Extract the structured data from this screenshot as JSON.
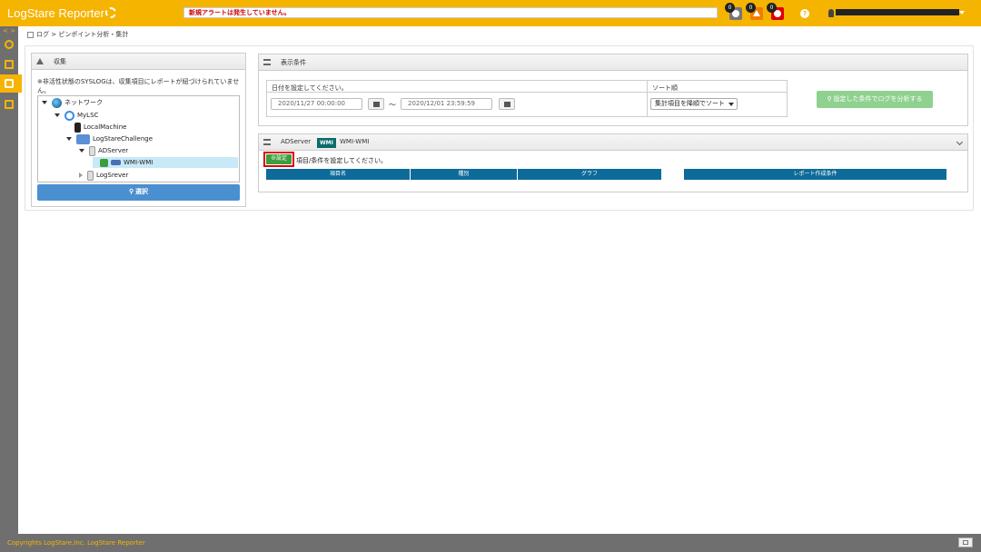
{
  "header": {
    "app_title": "LogStare Reporter",
    "alert_text": "新規アラートは発生していません。",
    "badges": {
      "info": "0",
      "warning": "0",
      "error": "0"
    },
    "help": "?",
    "colors": {
      "brand": "#f5b400",
      "alert_text": "#cc0000"
    }
  },
  "sidebar": {
    "toggle": "< >",
    "items": [
      {
        "name": "search",
        "icon": "search-icon"
      },
      {
        "name": "image",
        "icon": "image-icon"
      },
      {
        "name": "log",
        "icon": "speech-bubble-icon",
        "active": true
      },
      {
        "name": "report",
        "icon": "users-icon"
      }
    ]
  },
  "breadcrumb": "ログ > ピンポイント分析・集計",
  "collect_panel": {
    "title": "収集",
    "note": "※非活性状態のSYSLOGは、収集項目にレポートが紐づけられていません。",
    "tree": [
      {
        "label": "ネットワーク",
        "icon": "globe-icon",
        "level": 0
      },
      {
        "label": "MyLSC",
        "icon": "lsc-icon",
        "level": 1
      },
      {
        "label": "LocalMachine",
        "icon": "pc-icon",
        "level": 2
      },
      {
        "label": "LogStareChallenge",
        "icon": "group-icon",
        "level": 2
      },
      {
        "label": "ADServer",
        "icon": "server-icon",
        "level": 3
      },
      {
        "label": "WMI-WMI",
        "icon": "wmi-icon",
        "level": 4,
        "selected": true
      },
      {
        "label": "LogSrever",
        "icon": "server-icon",
        "level": 3
      }
    ],
    "select_button": "選択"
  },
  "condition_panel": {
    "title": "表示条件",
    "date_label": "日付を設定してください。",
    "date_from": "2020/11/27 00:00:00",
    "tilde": "～",
    "date_to": "2020/12/01 23:59:59",
    "sort_label": "ソート順",
    "sort_value": "集計項目を降順でソート",
    "analyze_button": "設定した条件でログを分析する"
  },
  "item_panel": {
    "server": "ADServer",
    "badge": "WMI",
    "badge_label": "WMI-WMI",
    "setting_button": "設定",
    "setting_message": "項目/条件を設定してください。",
    "columns": [
      "項目名",
      "種別",
      "グラフ",
      "レポート作成条件"
    ]
  },
  "footer": {
    "copyright": "Copyrights LogStare,Inc.  LogStare Reporter"
  }
}
